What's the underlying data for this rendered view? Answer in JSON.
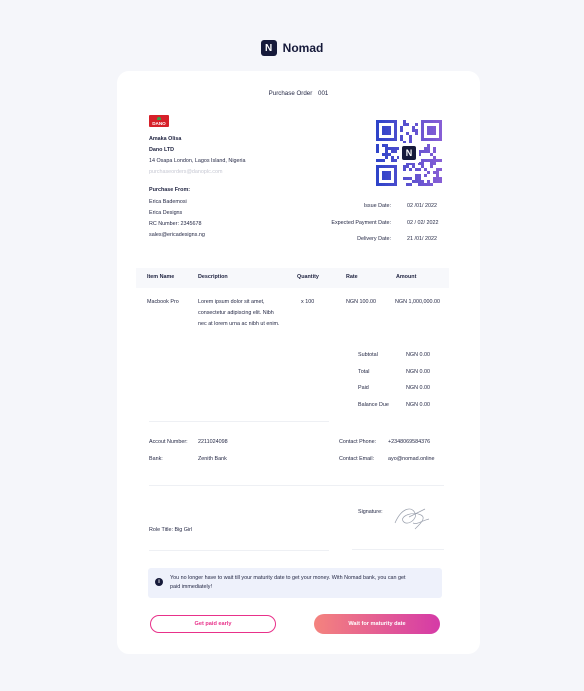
{
  "brand": {
    "name": "Nomad",
    "icon": "nomad-logo-icon"
  },
  "po": {
    "title": "Purchase Order",
    "number": "001"
  },
  "company_logo_text": "DANO",
  "from": {
    "name": "Amaka Olisa",
    "company": "Dano LTD",
    "address": "14 Osapa London, Lagos Island, Nigeria",
    "email": "purchaseorders@danoplc.com"
  },
  "purchase_from": {
    "heading": "Purchase From:",
    "name": "Erica Bademosi",
    "company": "Erica Designs",
    "rc": "RC Number: 2345678",
    "email": "sales@ericadesigns.ng"
  },
  "dates": {
    "issue_label": "Issue Date:",
    "issue_value": "02 /01/ 2022",
    "payment_label": "Expected Payment Date:",
    "payment_value": "02 / 02/ 2022",
    "delivery_label": "Delivery Date:",
    "delivery_value": "21 /01/ 2022"
  },
  "table": {
    "headers": [
      "Item Name",
      "Description",
      "Quantity",
      "Rate",
      "Amount"
    ],
    "row": {
      "item": "Macbook Pro",
      "desc1": "Lorem ipsum dolor sit amet,",
      "desc2": "consectetur adipiscing elit. Nibh",
      "desc3": "nec at lorem urna ac nibh ut enim.",
      "qty": "x 100",
      "rate": "NGN 100.00",
      "amount": "NGN 1,000,000.00"
    }
  },
  "totals": {
    "subtotal_label": "Subtotal",
    "subtotal_value": "NGN 0.00",
    "total_label": "Total",
    "total_value": "NGN 0.00",
    "paid_label": "Paid",
    "paid_value": "NGN 0.00",
    "balance_label": "Balance Due",
    "balance_value": "NGN 0.00"
  },
  "bank": {
    "account_label": "Accout Number:",
    "account_value": "2211024098",
    "bank_label": "Bank:",
    "bank_value": "Zenith Bank"
  },
  "contact": {
    "phone_label": "Contact Phone:",
    "phone_value": "+2348069584376",
    "email_label": "Contact Email:",
    "email_value": "ayo@nomad.online"
  },
  "signature": {
    "label": "Signature:"
  },
  "role": "Role Title: Big Girl",
  "info": {
    "line1": "You no longer have to wait till your maturity date to get your money. With Nomad bank, you can get",
    "line2": "paid immediately!"
  },
  "buttons": {
    "early": "Get paid early",
    "maturity": "Wait for maturity date"
  },
  "colors": {
    "accent": "#e8318a",
    "navy": "#161a3a",
    "qr_blue": "#2f44c9",
    "qr_purple": "#8a5fd6"
  }
}
